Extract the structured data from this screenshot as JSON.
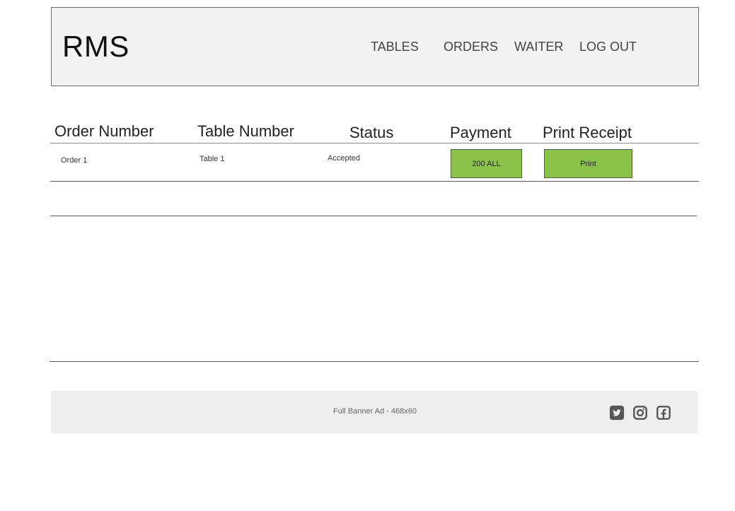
{
  "header": {
    "logo": "RMS",
    "nav": {
      "tables": "TABLES",
      "orders": "ORDERS",
      "waiter": "WAITER",
      "logout": "LOG OUT"
    }
  },
  "table": {
    "columns": {
      "order_number": "Order Number",
      "table_number": "Table Number",
      "status": "Status",
      "payment": "Payment",
      "print_receipt": "Print Receipt"
    },
    "rows": [
      {
        "order": "Order 1",
        "table": "Table 1",
        "status": "Accepted",
        "payment": "200 ALL",
        "print": "Print"
      }
    ]
  },
  "footer": {
    "banner_ad": "Full Banner Ad - 468x60",
    "social_icons": [
      "twitter-icon",
      "instagram-icon",
      "facebook-icon"
    ]
  },
  "colors": {
    "header_bg": "#f2f2f2",
    "button_green": "#8bc34a",
    "footer_bg": "#eeeeee",
    "icon_gray": "#555555"
  }
}
